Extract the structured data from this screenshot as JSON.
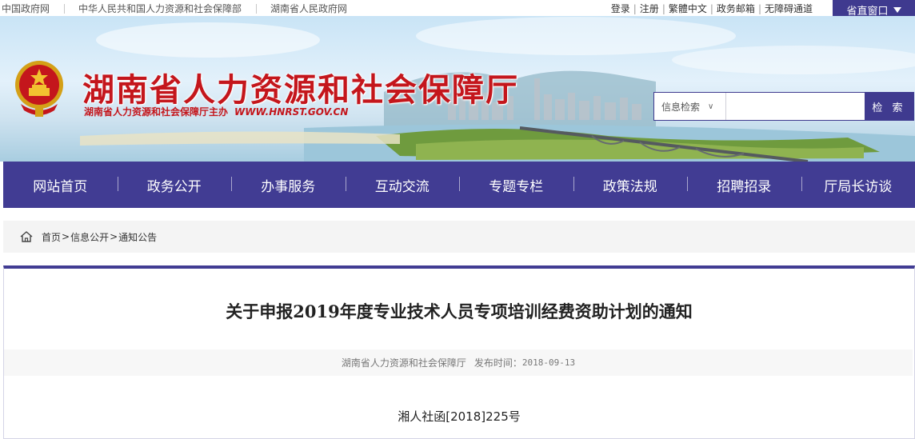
{
  "top_links": [
    "中国政府网",
    "中华人民共和国人力资源和社会保障部",
    "湖南省人民政府网"
  ],
  "user_links": [
    "登录",
    "注册",
    "繁體中文",
    "政务邮箱",
    "无障碍通道"
  ],
  "province_window": {
    "label": "省直窗口"
  },
  "header": {
    "site_title": "湖南省人力资源和社会保障厅",
    "sponsor": "湖南省人力资源和社会保障厅主办",
    "url": "WWW.HNRST.GOV.CN"
  },
  "search": {
    "scope_label": "信息检索",
    "placeholder": "",
    "button_label": "检 索"
  },
  "nav": [
    "网站首页",
    "政务公开",
    "办事服务",
    "互动交流",
    "专题专栏",
    "政策法规",
    "招聘招录",
    "厅局长访谈"
  ],
  "breadcrumb": [
    "首页",
    "信息公开",
    "通知公告"
  ],
  "article": {
    "title": "关于申报2019年度专业技术人员专项培训经费资助计划的通知",
    "publisher": "湖南省人力资源和社会保障厅",
    "date_label": "发布时间：",
    "date": "2018-09-13",
    "doc_number": "湘人社函[2018]225号"
  },
  "colors": {
    "primary": "#413c93",
    "title_red": "#c4161c"
  }
}
